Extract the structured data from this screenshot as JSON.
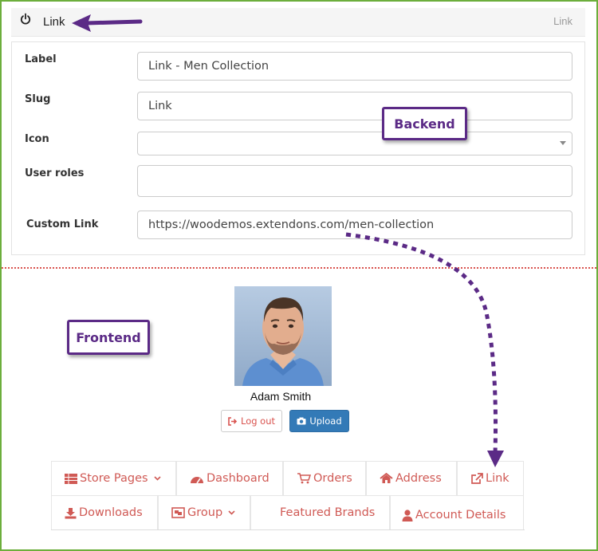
{
  "backend": {
    "header": {
      "title": "Link",
      "tag": "Link"
    },
    "fields": {
      "label": {
        "label": "Label",
        "value": "Link - Men Collection"
      },
      "slug": {
        "label": "Slug",
        "value": "Link"
      },
      "icon": {
        "label": "Icon",
        "value": ""
      },
      "user_roles": {
        "label": "User roles",
        "value": ""
      },
      "custom_link": {
        "label": "Custom Link",
        "value": "https://woodemos.extendons.com/men-collection"
      }
    }
  },
  "annotations": {
    "backend_label": "Backend",
    "frontend_label": "Frontend",
    "accent_color": "#5b2a86"
  },
  "frontend": {
    "user_name": "Adam Smith",
    "buttons": {
      "logout": "Log out",
      "upload": "Upload"
    },
    "menu": {
      "store_pages": "Store Pages",
      "dashboard": "Dashboard",
      "orders": "Orders",
      "address": "Address",
      "link": "Link",
      "downloads": "Downloads",
      "group": "Group",
      "featured_brands": "Featured Brands",
      "account_details": "Account Details"
    },
    "menu_color": "#d05a55"
  }
}
